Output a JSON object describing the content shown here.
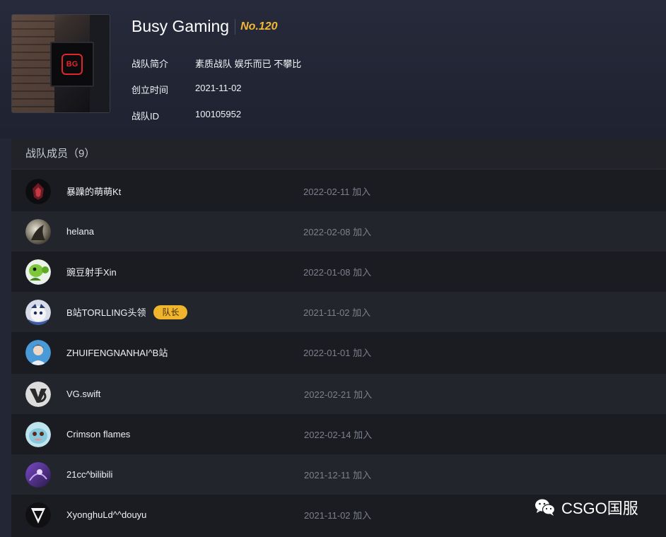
{
  "team": {
    "name": "Busy Gaming",
    "rank": "No.120",
    "logo_text": "BG",
    "info": [
      {
        "label": "战队简介",
        "value": "素质战队 娱乐而已 不攀比"
      },
      {
        "label": "创立时间",
        "value": "2021-11-02"
      },
      {
        "label": "战队ID",
        "value": "100105952"
      }
    ]
  },
  "members_section": {
    "title": "战队成员（9）",
    "members": [
      {
        "name": "暴躁的萌萌Kt",
        "date": "2022-02-11 加入",
        "badge": ""
      },
      {
        "name": "helana",
        "date": "2022-02-08 加入",
        "badge": ""
      },
      {
        "name": "豌豆射手Xin",
        "date": "2022-01-08 加入",
        "badge": ""
      },
      {
        "name": "B站TORLLING头领",
        "date": "2021-11-02 加入",
        "badge": "队长"
      },
      {
        "name": "ZHUIFENGNANHAI^B站",
        "date": "2022-01-01 加入",
        "badge": ""
      },
      {
        "name": "VG.swift",
        "date": "2022-02-21 加入",
        "badge": ""
      },
      {
        "name": "Crimson flames",
        "date": "2022-02-14 加入",
        "badge": ""
      },
      {
        "name": "21cc^bilibili",
        "date": "2021-12-11 加入",
        "badge": ""
      },
      {
        "name": "XyonghuLd^^douyu",
        "date": "2021-11-02 加入",
        "badge": ""
      }
    ]
  },
  "watermark": {
    "text": "CSGO国服",
    "icon": "wechat-icon"
  },
  "colors": {
    "accent": "#f1b833",
    "background": "#232634",
    "row_alt": "#23252d"
  }
}
